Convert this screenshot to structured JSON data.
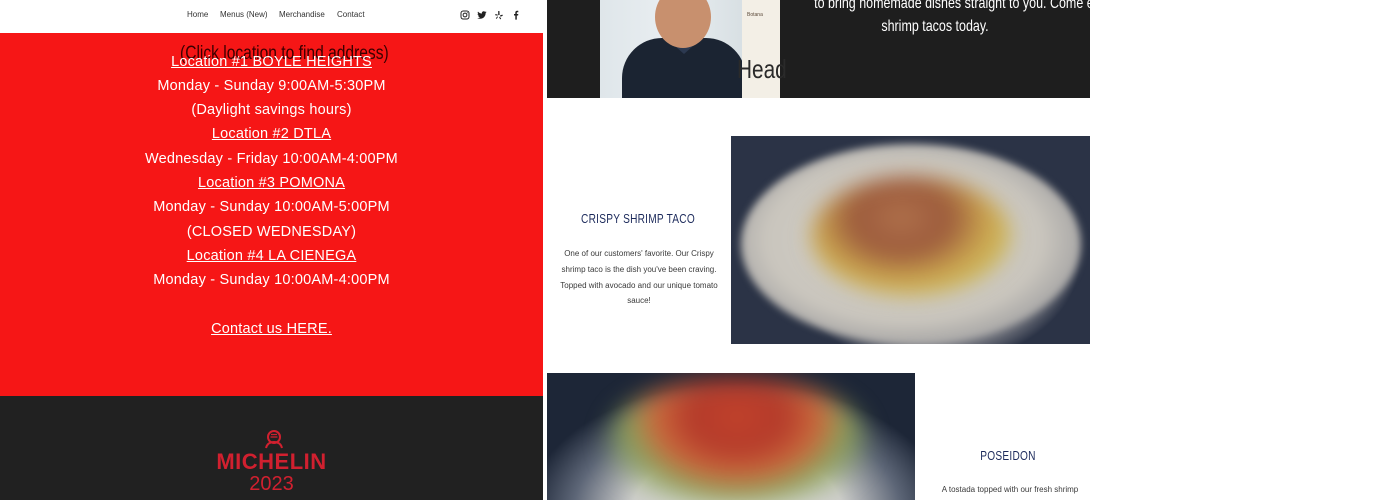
{
  "nav": {
    "items": [
      "Home",
      "Menus (New)",
      "Merchandise",
      "Contact"
    ]
  },
  "social": [
    "instagram-icon",
    "twitter-icon",
    "yelp-icon",
    "facebook-icon"
  ],
  "hours_panel": {
    "click_note": "(Click location to find address)",
    "lines": [
      "Location #1 BOYLE HEIGHTS",
      "Monday - Sunday 9:00AM-5:30PM",
      "(Daylight savings hours)",
      "Location #2 DTLA",
      "Wednesday - Friday 10:00AM-4:00PM",
      "Location #3 POMONA",
      "Monday - Sunday 10:00AM-5:00PM",
      "(CLOSED WEDNESDAY)",
      "Location #4 LA CIENEGA",
      "Monday - Sunday 10:00AM-4:00PM"
    ],
    "contact_link": "Contact us HERE."
  },
  "michelin": {
    "word": "MICHELIN",
    "year": "2023"
  },
  "hero": {
    "text_line1": "to bring homemade dishes straight to you. Come eat some of",
    "text_line2": "shrimp tacos today.",
    "poster_text": "Botana",
    "ghost_heading": "Head"
  },
  "menu_items": [
    {
      "title": "CRISPY SHRIMP TACO",
      "description": "One of our customers' favorite. Our Crispy shrimp taco is the dish you've been craving. Topped with avocado and our unique tomato sauce!"
    },
    {
      "title": "POSEIDON",
      "description": "A tostada topped with our fresh shrimp"
    }
  ],
  "colors": {
    "hours_bg": "#f61616",
    "footer_bg": "#212121",
    "michelin_red": "#d1202f",
    "item_title": "#1c2a5b"
  }
}
